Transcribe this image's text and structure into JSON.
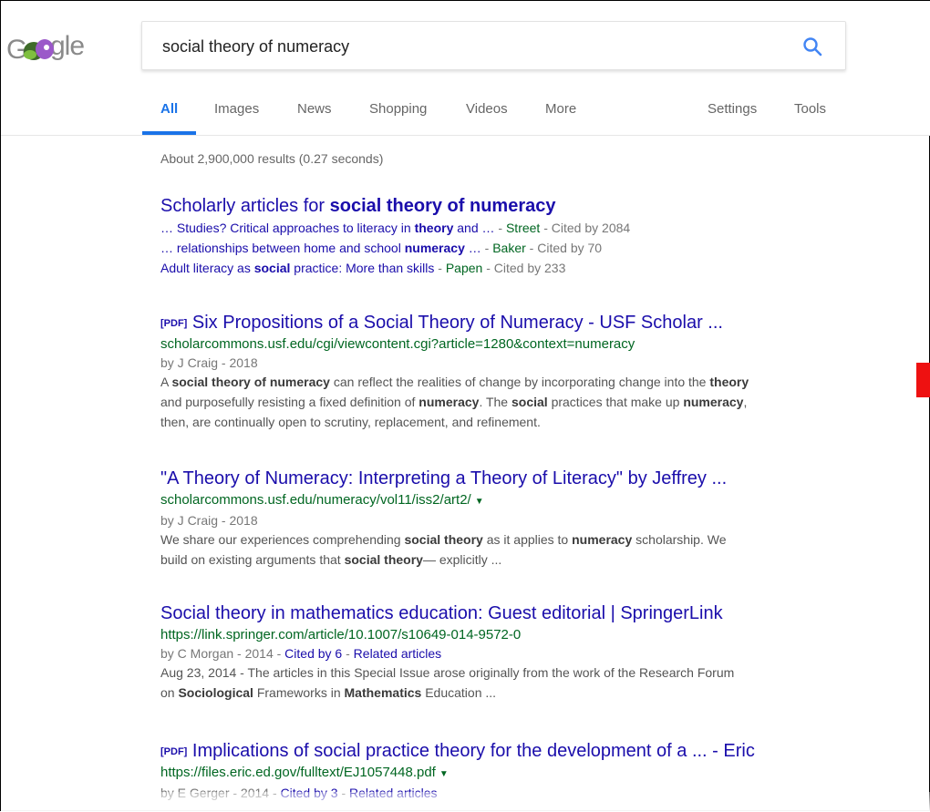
{
  "search": {
    "query": "social theory of numeracy"
  },
  "tabs": [
    {
      "label": "All"
    },
    {
      "label": "Images"
    },
    {
      "label": "News"
    },
    {
      "label": "Shopping"
    },
    {
      "label": "Videos"
    },
    {
      "label": "More"
    },
    {
      "label": "Settings"
    },
    {
      "label": "Tools"
    }
  ],
  "results_count": "About 2,900,000 results (0.27 seconds)",
  "scholarly": {
    "title_prefix": "Scholarly articles for ",
    "title_bold": "social theory of numeracy",
    "items": [
      {
        "p1": "… Studies? Critical approaches to literacy in ",
        "b1": "theory",
        "p2": " and …",
        "author": "Street",
        "cited": "Cited by 2084"
      },
      {
        "p1": "… relationships between home and school ",
        "b1": "numeracy",
        "p2": " …",
        "author": "Baker",
        "cited": "Cited by 70"
      },
      {
        "p1": "Adult literacy as ",
        "b1": "social",
        "p2": " practice: More than skills",
        "author": "Papen",
        "cited": "Cited by 233"
      }
    ]
  },
  "results": [
    {
      "pdf": "[PDF]",
      "title": "Six Propositions of a Social Theory of Numeracy - USF Scholar ...",
      "url": "scholarcommons.usf.edu/cgi/viewcontent.cgi?article=1280&context=numeracy",
      "meta": "by J Craig - 2018",
      "snippet_l1_a": "A ",
      "snippet_l1_b": "social theory of numeracy",
      "snippet_l1_c": " can reflect the realities of change by incorporating change into the ",
      "snippet_l1_d": "theory",
      "snippet_l2_a": "and purposefully resisting a fixed definition of ",
      "snippet_l2_b": "numeracy",
      "snippet_l2_c": ". The ",
      "snippet_l2_d": "social",
      "snippet_l2_e": " practices that make up ",
      "snippet_l2_f": "numeracy",
      "snippet_l2_g": ",",
      "snippet_l3": "then, are continually open to scrutiny, replacement, and refinement."
    },
    {
      "title": "\"A Theory of Numeracy: Interpreting a Theory of Literacy\" by Jeffrey ...",
      "url": "scholarcommons.usf.edu/numeracy/vol11/iss2/art2/",
      "caret": "▼",
      "meta": "by J Craig - 2018",
      "snippet_l1_a": "We share our experiences comprehending ",
      "snippet_l1_b": "social theory",
      "snippet_l1_c": " as it applies to ",
      "snippet_l1_d": "numeracy",
      "snippet_l1_e": " scholarship. We",
      "snippet_l2_a": "build on existing arguments that ",
      "snippet_l2_b": "social theory",
      "snippet_l2_c": "— explicitly ..."
    },
    {
      "title": "Social theory in mathematics education: Guest editorial | SpringerLink",
      "url": "https://link.springer.com/article/10.1007/s10649-014-9572-0",
      "meta_prefix": "by C Morgan - 2014 - ",
      "cited": "Cited by 6",
      "meta_sep": " - ",
      "related": "Related articles",
      "snippet_l1": "Aug 23, 2014 - The articles in this Special Issue arose originally from the work of the Research Forum",
      "snippet_l2_a": "on ",
      "snippet_l2_b": "Sociological",
      "snippet_l2_c": " Frameworks in ",
      "snippet_l2_d": "Mathematics",
      "snippet_l2_e": " Education ..."
    },
    {
      "pdf": "[PDF]",
      "title": "Implications of social practice theory for the development of a ... - Eric",
      "url": "https://files.eric.ed.gov/fulltext/EJ1057448.pdf",
      "caret": "▼",
      "meta_prefix": "by E Gerger - 2014 - ",
      "cited": "Cited by 3",
      "meta_sep": " - ",
      "related": "Related articles"
    }
  ],
  "colors": {
    "link": "#1a0dab",
    "url": "#006621",
    "accent": "#1a73e8",
    "marker": "#ee1111"
  }
}
